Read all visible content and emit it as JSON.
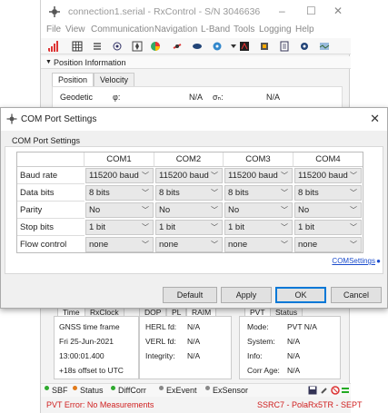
{
  "main_window": {
    "title": "connection1.serial - RxControl - S/N 3046636",
    "window_buttons": [
      "–",
      "☐",
      "✕"
    ],
    "menu": [
      "File",
      "View",
      "Communication",
      "Navigation",
      "L-Band",
      "Tools",
      "Logging",
      "Help"
    ],
    "position_section": "Position Information",
    "position_tabs": [
      "Position",
      "Velocity"
    ],
    "geodetic": {
      "label": "Geodetic",
      "phi": "φ:",
      "phi_val": "N/A",
      "sigma": "σₙ:",
      "sigma_val": "N/A"
    },
    "time_tabs": [
      "Time",
      "RxClock"
    ],
    "time_lines": [
      "GNSS time frame",
      "Fri 25-Jun-2021",
      "13:00:01.400",
      "+18s offset to UTC"
    ],
    "dop_tabs": [
      "DOP",
      "PL",
      "RAIM"
    ],
    "dop_rows": [
      [
        "HERL fd:",
        "N/A"
      ],
      [
        "VERL fd:",
        "N/A"
      ],
      [
        "Integrity:",
        "N/A"
      ]
    ],
    "pvt_tabs": [
      "PVT",
      "Status"
    ],
    "pvt_rows": [
      [
        "Mode:",
        "PVT N/A"
      ],
      [
        "System:",
        "N/A"
      ],
      [
        "Info:",
        "N/A"
      ],
      [
        "Corr Age:",
        "N/A"
      ]
    ],
    "status_items": [
      "SBF",
      "Status",
      "DiffCorr",
      "ExEvent",
      "ExSensor"
    ],
    "status_colors": [
      "#2eaa2e",
      "#e07a1a",
      "#2eaa2e",
      "#888888",
      "#888888"
    ],
    "error_text": "PVT Error: No Measurements",
    "receiver_text": "SSRC7 - PolaRx5TR - SEPT"
  },
  "dialog": {
    "title": "COM Port Settings",
    "group_label": "COM Port Settings",
    "columns": [
      "COM1",
      "COM2",
      "COM3",
      "COM4"
    ],
    "rows": [
      {
        "label": "Baud rate",
        "values": [
          "115200 baud",
          "115200 baud",
          "115200 baud",
          "115200 baud"
        ]
      },
      {
        "label": "Data bits",
        "values": [
          "8 bits",
          "8 bits",
          "8 bits",
          "8 bits"
        ]
      },
      {
        "label": "Parity",
        "values": [
          "No",
          "No",
          "No",
          "No"
        ]
      },
      {
        "label": "Stop bits",
        "values": [
          "1 bit",
          "1 bit",
          "1 bit",
          "1 bit"
        ]
      },
      {
        "label": "Flow control",
        "values": [
          "none",
          "none",
          "none",
          "none"
        ]
      }
    ],
    "link": "COMSettings",
    "buttons": {
      "default": "Default",
      "apply": "Apply",
      "ok": "OK",
      "cancel": "Cancel"
    }
  },
  "colors": {
    "accent": "#0078d7",
    "error": "#d02020",
    "link": "#1a4bcc"
  }
}
